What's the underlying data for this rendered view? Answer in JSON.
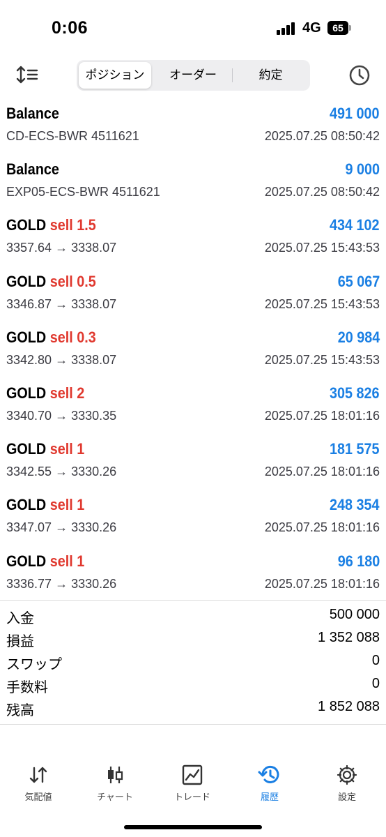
{
  "status_bar": {
    "time": "0:06",
    "network": "4G",
    "battery": "65"
  },
  "toolbar": {
    "segments": [
      "ポジション",
      "オーダー",
      "約定"
    ],
    "active_segment": "ポジション"
  },
  "deals": [
    {
      "title": "Balance",
      "side": "",
      "amount": "491 000",
      "sub": "CD-ECS-BWR 4511621",
      "date": "2025.07.25 08:50:42"
    },
    {
      "title": "Balance",
      "side": "",
      "amount": "9 000",
      "sub": "EXP05-ECS-BWR 4511621",
      "date": "2025.07.25 08:50:42"
    },
    {
      "title": "GOLD",
      "side": "sell 1.5",
      "amount": "434 102",
      "sub": "3357.64 → 3338.07",
      "date": "2025.07.25 15:43:53"
    },
    {
      "title": "GOLD",
      "side": "sell 0.5",
      "amount": "65 067",
      "sub": "3346.87 → 3338.07",
      "date": "2025.07.25 15:43:53"
    },
    {
      "title": "GOLD",
      "side": "sell 0.3",
      "amount": "20 984",
      "sub": "3342.80 → 3338.07",
      "date": "2025.07.25 15:43:53"
    },
    {
      "title": "GOLD",
      "side": "sell 2",
      "amount": "305 826",
      "sub": "3340.70 → 3330.35",
      "date": "2025.07.25 18:01:16"
    },
    {
      "title": "GOLD",
      "side": "sell 1",
      "amount": "181 575",
      "sub": "3342.55 → 3330.26",
      "date": "2025.07.25 18:01:16"
    },
    {
      "title": "GOLD",
      "side": "sell 1",
      "amount": "248 354",
      "sub": "3347.07 → 3330.26",
      "date": "2025.07.25 18:01:16"
    },
    {
      "title": "GOLD",
      "side": "sell 1",
      "amount": "96 180",
      "sub": "3336.77 → 3330.26",
      "date": "2025.07.25 18:01:16"
    }
  ],
  "summary": [
    {
      "label": "入金",
      "value": "500 000"
    },
    {
      "label": "損益",
      "value": "1 352 088"
    },
    {
      "label": "スワップ",
      "value": "0"
    },
    {
      "label": "手数料",
      "value": "0"
    },
    {
      "label": "残高",
      "value": "1 852 088"
    }
  ],
  "tabs": [
    {
      "label": "気配値",
      "icon": "quotes-icon"
    },
    {
      "label": "チャート",
      "icon": "chart-candles-icon"
    },
    {
      "label": "トレード",
      "icon": "trade-icon"
    },
    {
      "label": "履歴",
      "icon": "history-icon"
    },
    {
      "label": "設定",
      "icon": "settings-gear-icon"
    }
  ],
  "active_tab": "履歴",
  "colors": {
    "accent": "#1a7fe3",
    "sell": "#e0382e"
  }
}
